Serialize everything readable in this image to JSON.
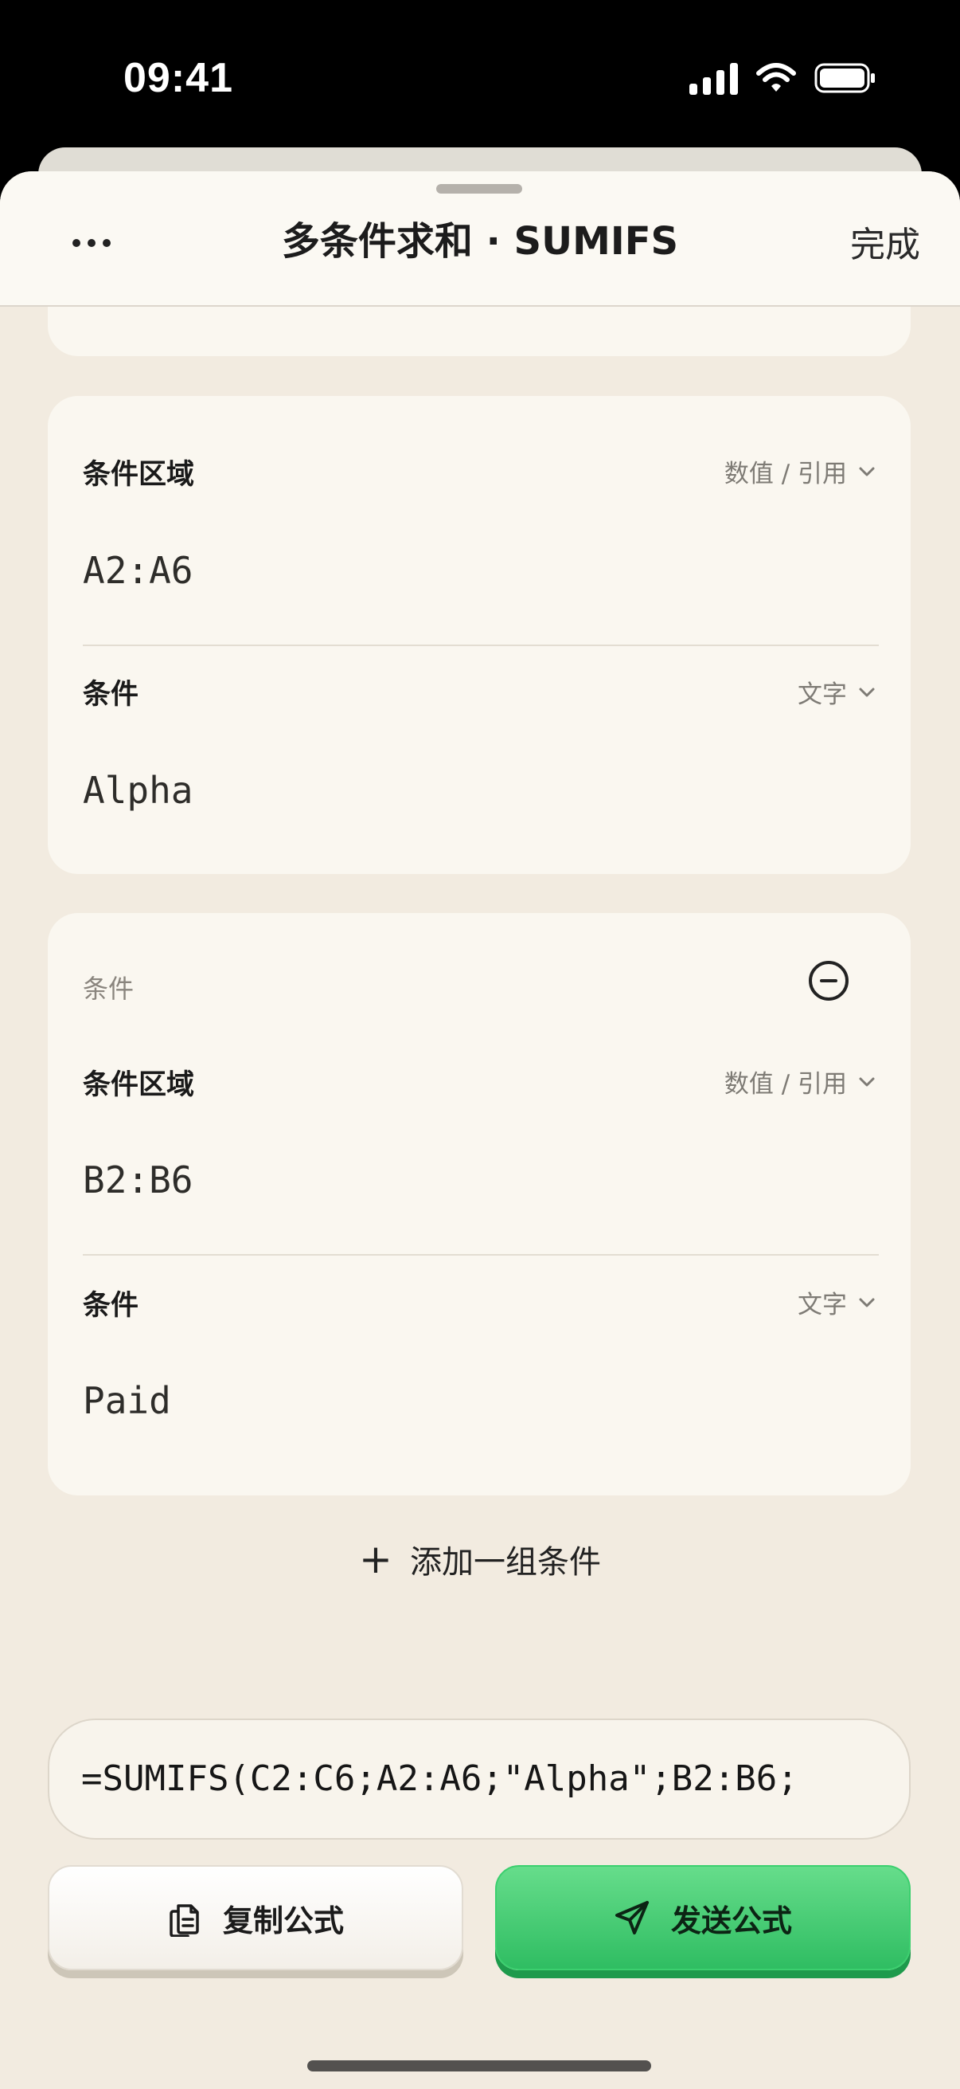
{
  "status_bar": {
    "time": "09:41"
  },
  "nav": {
    "title": "多条件求和 · SUMIFS",
    "done": "完成"
  },
  "condition_groups": [
    {
      "header": "",
      "range_label": "条件区域",
      "range_type": "数值 / 引用",
      "range_value": "A2:A6",
      "criteria_label": "条件",
      "criteria_type": "文字",
      "criteria_value": "Alpha"
    },
    {
      "header": "条件",
      "range_label": "条件区域",
      "range_type": "数值 / 引用",
      "range_value": "B2:B6",
      "criteria_label": "条件",
      "criteria_type": "文字",
      "criteria_value": "Paid"
    }
  ],
  "add_group": {
    "plus": "+",
    "label": "添加一组条件"
  },
  "formula": "=SUMIFS(C2:C6;A2:A6;\"Alpha\";B2:B6;",
  "actions": {
    "copy": "复制公式",
    "send": "发送公式"
  },
  "colors": {
    "send_green": "#3ccf6f",
    "background": "#f2ebe0",
    "card": "#faf7f0"
  },
  "icons": [
    "more-icon",
    "chevron-down-icon",
    "minus-circle-icon",
    "plus-icon",
    "copy-icon",
    "send-icon"
  ]
}
